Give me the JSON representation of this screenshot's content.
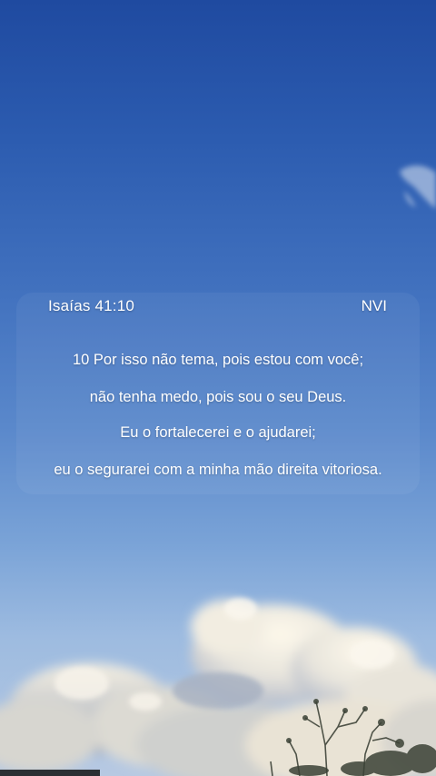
{
  "verse": {
    "reference": "Isaías 41:10",
    "version": "NVI",
    "lines": [
      "10 Por isso não tema, pois estou com você;",
      "não tenha medo, pois sou o seu Deus.",
      "Eu o fortalecerei e o ajudarei;",
      "eu o segurarei com a minha mão direita vitoriosa."
    ]
  },
  "background": {
    "sky_top_color": "#1f4aa0",
    "sky_bottom_color": "#b7c9e2",
    "cloud_color": "#f1eee6"
  }
}
